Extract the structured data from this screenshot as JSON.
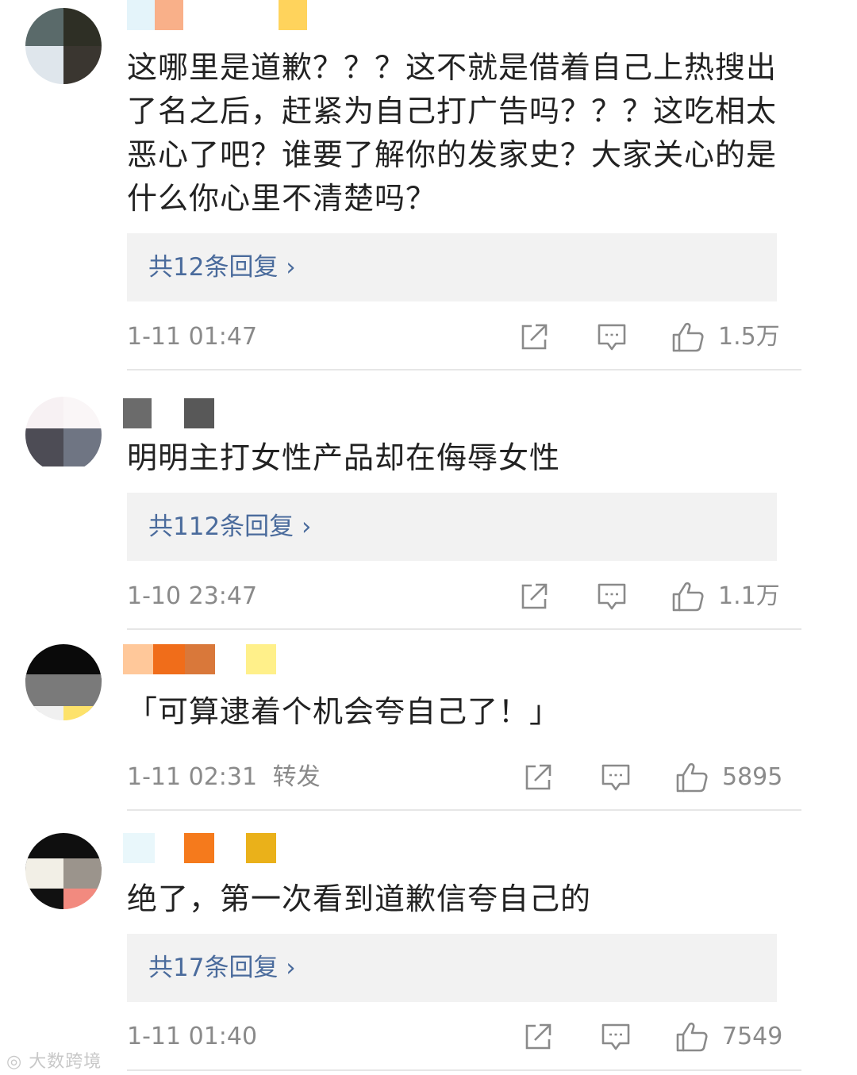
{
  "comments": [
    {
      "text": "这哪里是道歉？？？这不就是借着自己上热搜出了名之后，赶紧为自己打广告吗？？？这吃相太恶心了吧？谁要了解你的发家史？大家关心的是什么你心里不清楚吗？",
      "replies": "共12条回复 ›",
      "time": "1-11 01:47",
      "likes": "1.5万"
    },
    {
      "text": "明明主打女性产品却在侮辱女性",
      "replies": "共112条回复 ›",
      "time": "1-10 23:47",
      "likes": "1.1万"
    },
    {
      "text": "「可算逮着个机会夸自己了！」",
      "time": "1-11 02:31",
      "tag": "转发",
      "likes": "5895"
    },
    {
      "text": "绝了，第一次看到道歉信夸自己的",
      "replies": "共17条回复 ›",
      "time": "1-11 01:40",
      "likes": "7549"
    }
  ],
  "icons": {
    "share": "share-icon",
    "comment": "comment-icon",
    "like": "thumbs-up-icon"
  },
  "colors": {
    "link": "#4a6b9c",
    "meta": "#8a8a8a",
    "reply_bg": "#f2f2f2"
  },
  "watermark": "大数跨境"
}
